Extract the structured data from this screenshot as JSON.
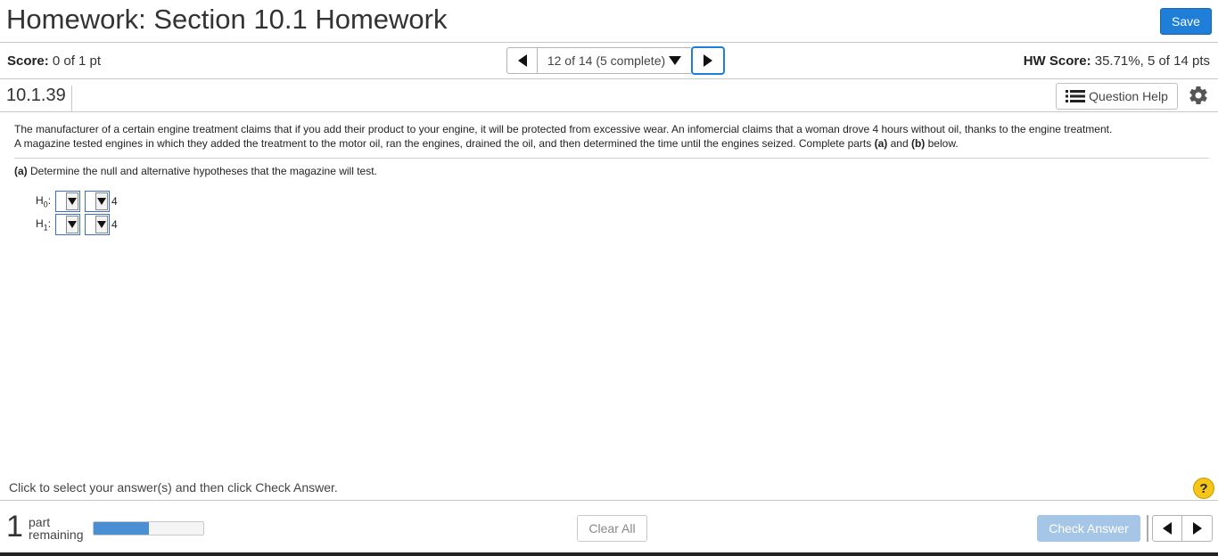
{
  "header": {
    "title": "Homework: Section 10.1 Homework",
    "save_label": "Save"
  },
  "score_bar": {
    "score_label": "Score:",
    "score_value": "0 of 1 pt",
    "nav_text": "12 of 14 (5 complete)",
    "hw_score_label": "HW Score:",
    "hw_score_value": "35.71%, 5 of 14 pts"
  },
  "question_bar": {
    "question_id": "10.1.39",
    "help_label": "Question Help"
  },
  "problem": {
    "line1": "The manufacturer of a certain engine treatment claims that if you add their product to your engine, it will be protected from excessive wear. An infomercial claims that a woman drove 4 hours without oil, thanks to the engine treatment.",
    "line2_start": "A magazine tested engines in which they added the treatment to the motor oil, ran the engines, drained the oil, and then determined the time until the engines seized. Complete parts ",
    "part_a_bold": "(a)",
    "and": " and ",
    "part_b_bold": "(b)",
    "line2_end": " below."
  },
  "part_a": {
    "label": "(a)",
    "text": " Determine the null and alternative hypotheses that the magazine will test."
  },
  "hypotheses": [
    {
      "letter": "H",
      "sub": "0",
      "value": "4"
    },
    {
      "letter": "H",
      "sub": "1",
      "value": "4"
    }
  ],
  "footer": {
    "instruction": "Click to select your answer(s) and then click Check Answer.",
    "parts_count": "1",
    "parts_line1": "part",
    "parts_line2": "remaining",
    "progress_fraction": 0.5,
    "clear_label": "Clear All",
    "check_label": "Check Answer",
    "help_symbol": "?"
  }
}
